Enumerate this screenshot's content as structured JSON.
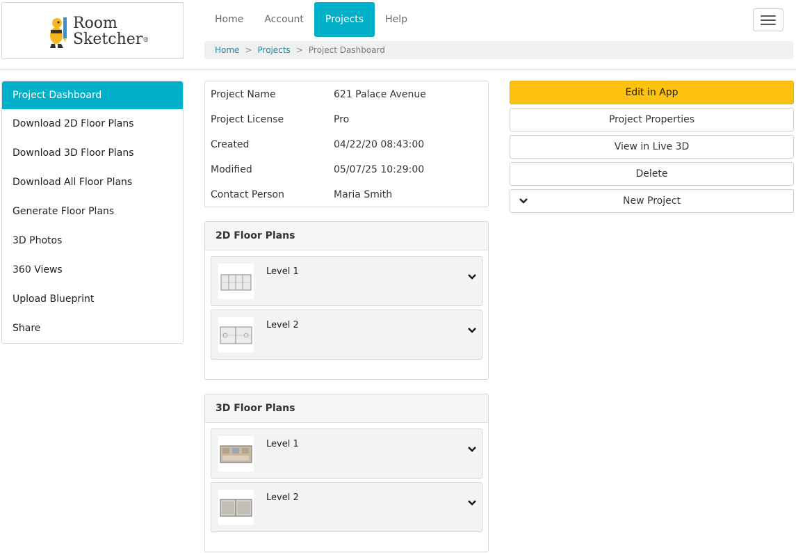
{
  "brand": {
    "line1": "Room",
    "line2": "Sketcher",
    "mark": "®"
  },
  "nav": [
    {
      "label": "Home"
    },
    {
      "label": "Account"
    },
    {
      "label": "Projects",
      "active": true
    },
    {
      "label": "Help"
    }
  ],
  "breadcrumb": {
    "home": "Home",
    "projects": "Projects",
    "current": "Project Dashboard",
    "separator": ">"
  },
  "sidebar": {
    "items": [
      {
        "label": "Project Dashboard",
        "active": true
      },
      {
        "label": "Download 2D Floor Plans"
      },
      {
        "label": "Download 3D Floor Plans"
      },
      {
        "label": "Download All Floor Plans"
      },
      {
        "label": "Generate Floor Plans"
      },
      {
        "label": "3D Photos"
      },
      {
        "label": "360 Views"
      },
      {
        "label": "Upload Blueprint"
      },
      {
        "label": "Share"
      }
    ]
  },
  "project": {
    "rows": [
      {
        "key": "Project Name",
        "value": "621 Palace Avenue"
      },
      {
        "key": "Project License",
        "value": "Pro"
      },
      {
        "key": "Created",
        "value": "04/22/20 08:43:00"
      },
      {
        "key": "Modified",
        "value": "05/07/25 10:29:00"
      },
      {
        "key": "Contact Person",
        "value": "Maria Smith"
      }
    ]
  },
  "plans2d": {
    "title": "2D Floor Plans",
    "levels": [
      "Level 1",
      "Level 2"
    ]
  },
  "plans3d": {
    "title": "3D Floor Plans",
    "levels": [
      "Level 1",
      "Level 2"
    ]
  },
  "actions": {
    "edit": "Edit in App",
    "properties": "Project Properties",
    "live3d": "View in Live 3D",
    "delete": "Delete",
    "new_project": "New Project"
  },
  "colors": {
    "accent": "#00b0c8",
    "primary_button": "#fdc110",
    "link": "#1a8aa6"
  },
  "icons": {
    "menu": "hamburger-icon",
    "expand": "chevron-down-icon"
  }
}
